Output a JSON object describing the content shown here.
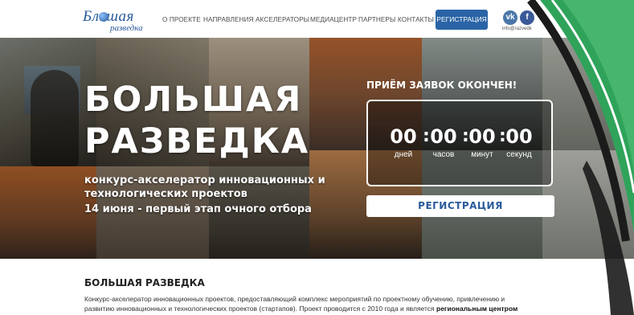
{
  "header": {
    "logo_main": "Бльшая",
    "logo_sub": "разведка",
    "nav": [
      {
        "label": "О ПРОЕКТЕ"
      },
      {
        "label": "НАПРАВЛЕНИЯ"
      },
      {
        "label": "АКСЕЛЕРАТОРЫ"
      },
      {
        "label": "МЕДИАЦЕНТР"
      },
      {
        "label": "ПАРТНЕРЫ"
      },
      {
        "label": "КОНТАКТЫ"
      }
    ],
    "register_label": "РЕГИСТРАЦИЯ",
    "social": {
      "vk": "vk",
      "fb": "f"
    },
    "email": "info@razvedk"
  },
  "hero": {
    "title_line1": "БОЛЬШАЯ",
    "title_line2": "РАЗВЕДКА",
    "subtitle_line1": "конкурс-акселератор инновационных и",
    "subtitle_line2": "технологических проектов",
    "subtitle_line3": "14 июня - первый этап очного отбора",
    "closed_text": "ПРИЁМ ЗАЯВОК ОКОНЧЕН!",
    "countdown": [
      {
        "value": "00",
        "label": "дней"
      },
      {
        "value": "00",
        "label": "часов"
      },
      {
        "value": "00",
        "label": "минут"
      },
      {
        "value": "00",
        "label": "секунд"
      }
    ],
    "separator": ":",
    "cta_label": "РЕГИСТРАЦИЯ"
  },
  "about": {
    "title": "БОЛЬШАЯ РАЗВЕДКА",
    "text_line1": "Конкурс-акселератор инновационных проектов, предоставляющий комплекс мероприятий по проектному обучению, привлечению и",
    "text_line2_plain": "развитию инновационных и технологических проектов (стартапов). Проект проводится с 2010 года и является ",
    "text_line2_bold": "региональным центром"
  },
  "colors": {
    "brand_blue": "#2a64a6",
    "header_bg": "#ffffff",
    "swoosh_green": "#2fa35a"
  }
}
